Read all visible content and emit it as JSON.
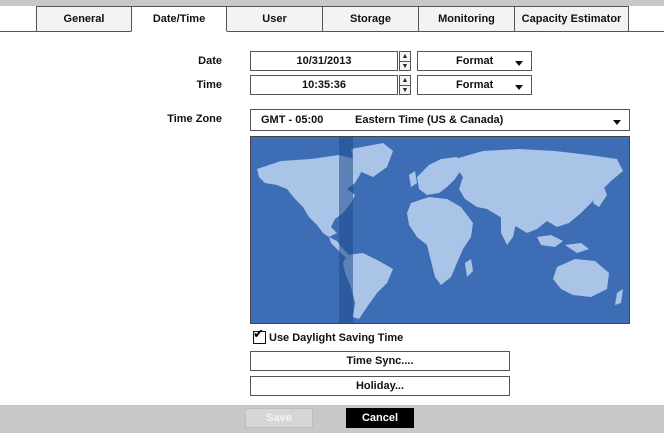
{
  "tabs": [
    {
      "label": "General",
      "active": false
    },
    {
      "label": "Date/Time",
      "active": true
    },
    {
      "label": "User",
      "active": false
    },
    {
      "label": "Storage",
      "active": false
    },
    {
      "label": "Monitoring",
      "active": false
    },
    {
      "label": "Capacity Estimator",
      "active": false
    }
  ],
  "form": {
    "date_label": "Date",
    "date_value": "10/31/2013",
    "date_format": "Format",
    "time_label": "Time",
    "time_value": "10:35:36",
    "time_format": "Format",
    "timezone_label": "Time Zone",
    "timezone_offset": "GMT - 05:00",
    "timezone_name": "Eastern Time (US & Canada)"
  },
  "map": {
    "ocean_color": "#3d6eb5",
    "land_color": "#a9c4e6",
    "highlight_color": "#2a4f8f"
  },
  "options": {
    "dst_label": "Use Daylight Saving Time",
    "dst_checked": true,
    "time_sync_label": "Time Sync....",
    "holiday_label": "Holiday..."
  },
  "footer": {
    "save_label": "Save",
    "cancel_label": "Cancel"
  }
}
